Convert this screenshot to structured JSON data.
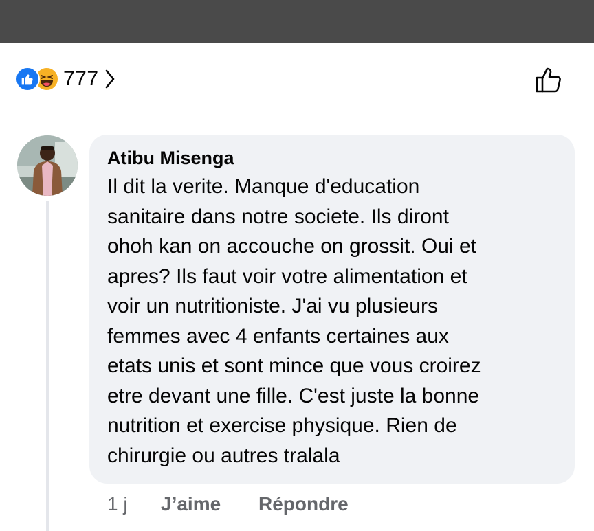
{
  "reactions": {
    "icons": [
      "like-icon",
      "haha-icon"
    ],
    "count": "777",
    "colors": {
      "like": "#1877f2",
      "haha": "#f7b125"
    }
  },
  "comment": {
    "author": "Atibu Misenga",
    "text": "Il dit la verite. Manque d'education\nsanitaire dans notre societe. Ils diront\nohoh kan on accouche on grossit. Oui et\napres? Ils faut voir votre alimentation et\nvoir un nutritioniste. J'ai vu plusieurs\nfemmes avec  4 enfants certaines aux\netats unis et sont mince que vous croirez\netre devant une fille. C'est juste la bonne\nnutrition et exercise physique. Rien de\nchirurgie ou autres tralala",
    "time": "1 j",
    "like_label": "J’aime",
    "reply_label": "Répondre"
  },
  "colors": {
    "bubble": "#f0f2f5",
    "secondary_text": "#65676b",
    "topbar": "#4a4a4a"
  }
}
